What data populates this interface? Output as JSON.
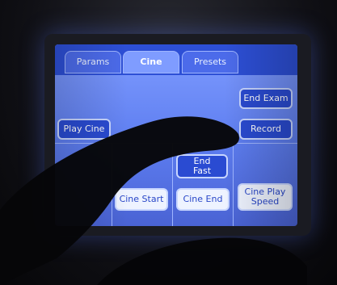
{
  "tabs": [
    {
      "label": "Params",
      "active": false
    },
    {
      "label": "Cine",
      "active": true
    },
    {
      "label": "Presets",
      "active": false
    }
  ],
  "buttons": {
    "end_exam": "End Exam",
    "play_cine": "Play Cine",
    "record": "Record",
    "go_end_fast": "End\nFast",
    "cine_start": "Cine Start",
    "cine_end": "Cine End",
    "cine_play_speed": "Cine Play\nSpeed"
  },
  "colors": {
    "screen": "#7f9cff",
    "tabbar": "#2d4fd6",
    "button_dark": "#2a4bd2",
    "button_light": "#eef3ff"
  }
}
